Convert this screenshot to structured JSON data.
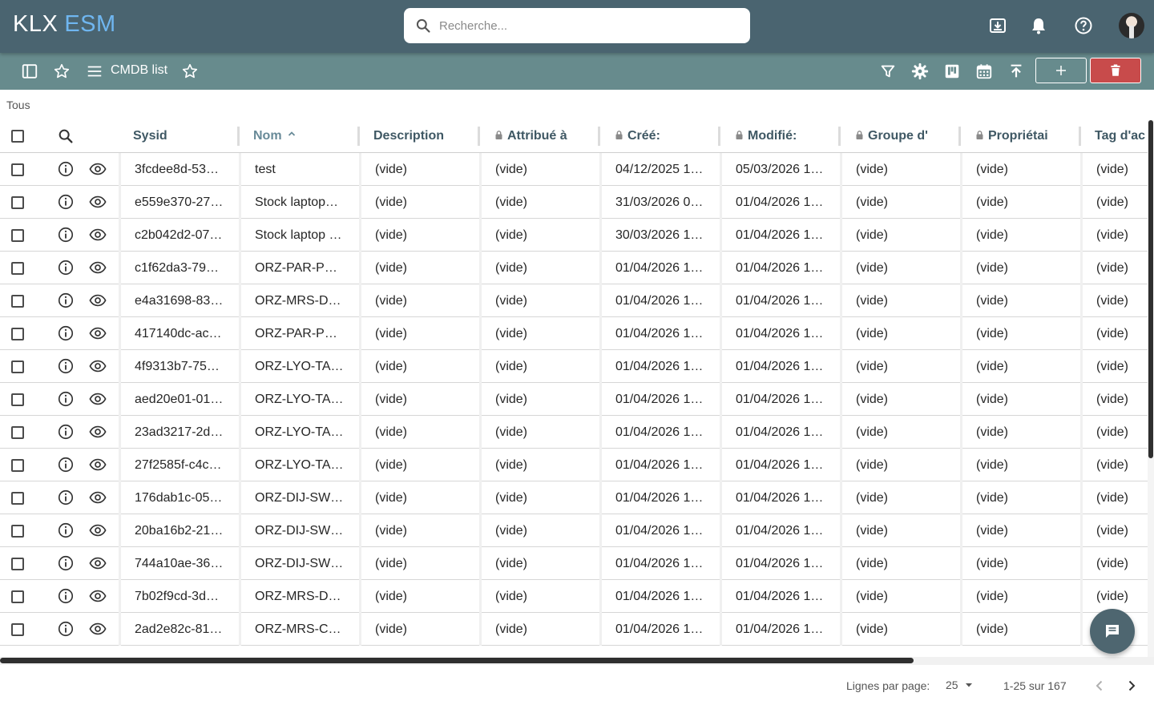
{
  "app": {
    "logo_primary": "KLX",
    "logo_secondary": "ESM"
  },
  "search": {
    "placeholder": "Recherche..."
  },
  "toolbar": {
    "title": "CMDB list"
  },
  "filter": {
    "label": "Tous"
  },
  "table": {
    "columns": [
      "Sysid",
      "Nom",
      "Description",
      "Attribué à",
      "Créé:",
      "Modifié:",
      "Groupe d'",
      "Propriétai",
      "Tag d'ac"
    ],
    "sorted_column": "Nom",
    "rows": [
      [
        "3fcdee8d-53…",
        "test",
        "(vide)",
        "(vide)",
        "04/12/2025 1…",
        "05/03/2026 1…",
        "(vide)",
        "(vide)",
        "(vide)"
      ],
      [
        "e559e370-27…",
        "Stock laptop…",
        "(vide)",
        "(vide)",
        "31/03/2026 0…",
        "01/04/2026 1…",
        "(vide)",
        "(vide)",
        "(vide)"
      ],
      [
        "c2b042d2-07…",
        "Stock laptop …",
        "(vide)",
        "(vide)",
        "30/03/2026 1…",
        "01/04/2026 1…",
        "(vide)",
        "(vide)",
        "(vide)"
      ],
      [
        "c1f62da3-79…",
        "ORZ-PAR-P…",
        "(vide)",
        "(vide)",
        "01/04/2026 1…",
        "01/04/2026 1…",
        "(vide)",
        "(vide)",
        "(vide)"
      ],
      [
        "e4a31698-83…",
        "ORZ-MRS-D…",
        "(vide)",
        "(vide)",
        "01/04/2026 1…",
        "01/04/2026 1…",
        "(vide)",
        "(vide)",
        "(vide)"
      ],
      [
        "417140dc-ac…",
        "ORZ-PAR-P…",
        "(vide)",
        "(vide)",
        "01/04/2026 1…",
        "01/04/2026 1…",
        "(vide)",
        "(vide)",
        "(vide)"
      ],
      [
        "4f9313b7-75…",
        "ORZ-LYO-TA…",
        "(vide)",
        "(vide)",
        "01/04/2026 1…",
        "01/04/2026 1…",
        "(vide)",
        "(vide)",
        "(vide)"
      ],
      [
        "aed20e01-01…",
        "ORZ-LYO-TA…",
        "(vide)",
        "(vide)",
        "01/04/2026 1…",
        "01/04/2026 1…",
        "(vide)",
        "(vide)",
        "(vide)"
      ],
      [
        "23ad3217-2d…",
        "ORZ-LYO-TA…",
        "(vide)",
        "(vide)",
        "01/04/2026 1…",
        "01/04/2026 1…",
        "(vide)",
        "(vide)",
        "(vide)"
      ],
      [
        "27f2585f-c4c…",
        "ORZ-LYO-TA…",
        "(vide)",
        "(vide)",
        "01/04/2026 1…",
        "01/04/2026 1…",
        "(vide)",
        "(vide)",
        "(vide)"
      ],
      [
        "176dab1c-05…",
        "ORZ-DIJ-SW…",
        "(vide)",
        "(vide)",
        "01/04/2026 1…",
        "01/04/2026 1…",
        "(vide)",
        "(vide)",
        "(vide)"
      ],
      [
        "20ba16b2-21…",
        "ORZ-DIJ-SW…",
        "(vide)",
        "(vide)",
        "01/04/2026 1…",
        "01/04/2026 1…",
        "(vide)",
        "(vide)",
        "(vide)"
      ],
      [
        "744a10ae-36…",
        "ORZ-DIJ-SW…",
        "(vide)",
        "(vide)",
        "01/04/2026 1…",
        "01/04/2026 1…",
        "(vide)",
        "(vide)",
        "(vide)"
      ],
      [
        "7b02f9cd-3d…",
        "ORZ-MRS-D…",
        "(vide)",
        "(vide)",
        "01/04/2026 1…",
        "01/04/2026 1…",
        "(vide)",
        "(vide)",
        "(vide)"
      ],
      [
        "2ad2e82c-81…",
        "ORZ-MRS-C…",
        "(vide)",
        "(vide)",
        "01/04/2026 1…",
        "01/04/2026 1…",
        "(vide)",
        "(vide)",
        "(vide)"
      ]
    ]
  },
  "pagination": {
    "rows_label": "Lignes par page:",
    "rows_per_page": "25",
    "range": "1-25 sur 167"
  },
  "colors": {
    "topbar": "#4a6470",
    "toolbar": "#678b8d",
    "accent": "#6fb6f0",
    "delete": "#c84b4b"
  },
  "icons": [
    "search-icon",
    "download-icon",
    "bell-icon",
    "help-icon",
    "sidebar-toggle-icon",
    "star-icon",
    "menu-icon",
    "filter-icon",
    "gear-icon",
    "kanban-icon",
    "calendar-icon",
    "upload-icon",
    "plus-icon",
    "trash-icon",
    "info-icon",
    "eye-icon",
    "chat-icon"
  ]
}
